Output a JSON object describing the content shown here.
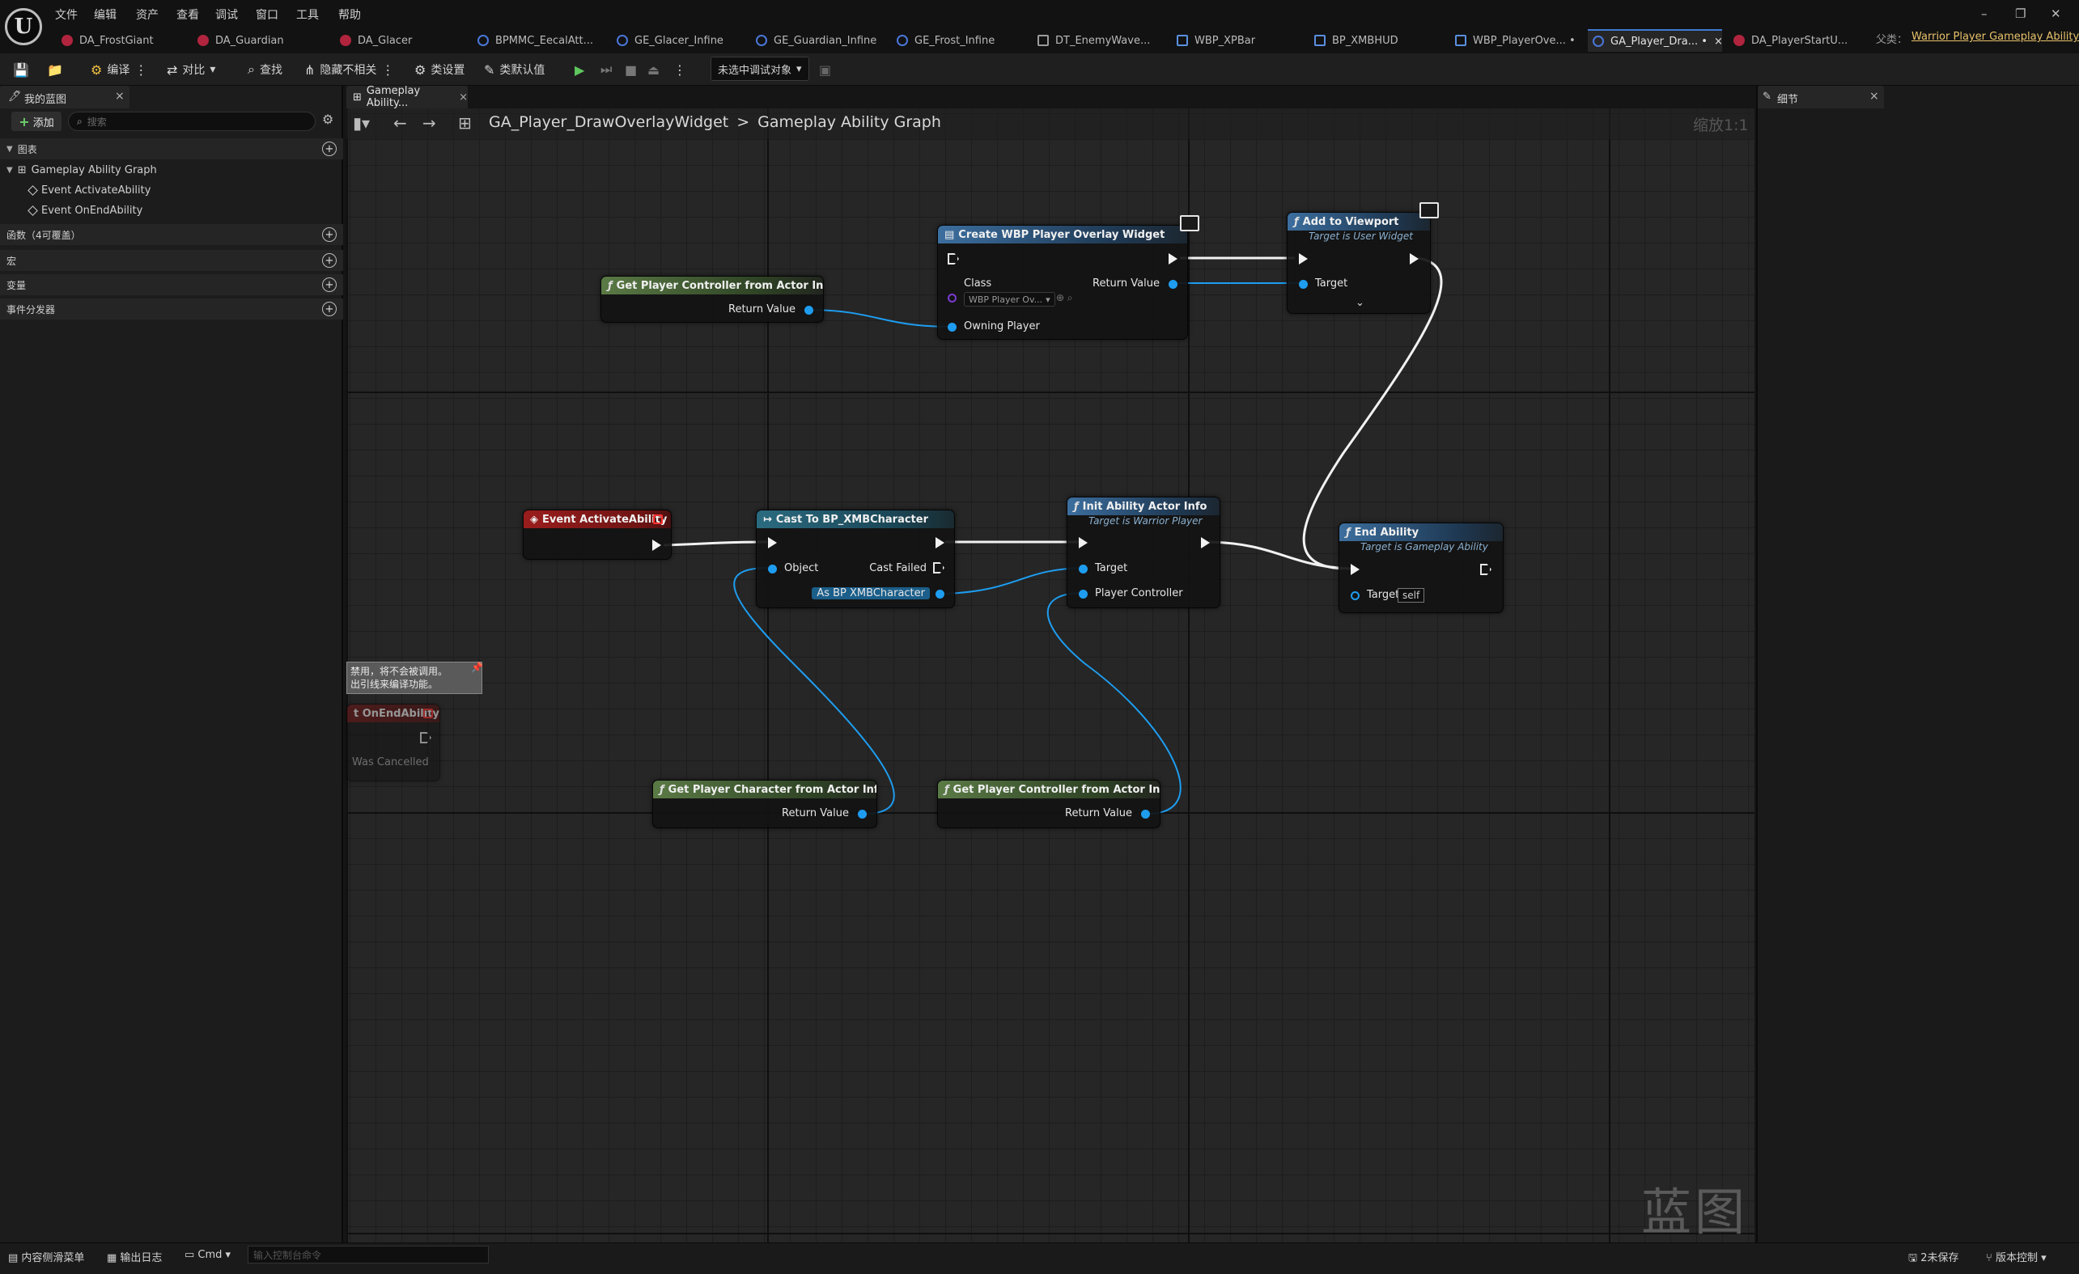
{
  "menu": [
    "文件",
    "编辑",
    "资产",
    "查看",
    "调试",
    "窗口",
    "工具",
    "帮助"
  ],
  "tabs": [
    {
      "label": "DA_FrostGiant",
      "icon": "data-asset-icon"
    },
    {
      "label": "DA_Guardian",
      "icon": "data-asset-icon"
    },
    {
      "label": "DA_Glacer",
      "icon": "data-asset-icon"
    },
    {
      "label": "BPMMC_EecalAtt...",
      "icon": "blueprint-icon"
    },
    {
      "label": "GE_Glacer_Infine",
      "icon": "blueprint-icon"
    },
    {
      "label": "GE_Guardian_Infine",
      "icon": "blueprint-icon"
    },
    {
      "label": "GE_Frost_Infine",
      "icon": "blueprint-icon"
    },
    {
      "label": "DT_EnemyWave...",
      "icon": "data-table-icon"
    },
    {
      "label": "WBP_XPBar",
      "icon": "widget-blueprint-icon"
    },
    {
      "label": "BP_XMBHUD",
      "icon": "blueprint-class-icon"
    },
    {
      "label": "WBP_PlayerOve... •",
      "icon": "widget-blueprint-icon"
    },
    {
      "label": "GA_Player_Dra... •",
      "icon": "blueprint-icon",
      "active": true
    },
    {
      "label": "DA_PlayerStartU...",
      "icon": "data-asset-icon"
    }
  ],
  "tab_close": "×",
  "parent_class_label": "父类：",
  "parent_class": "Warrior Player Gameplay Ability",
  "window_controls": {
    "minimize": "–",
    "restore": "❐",
    "close": "✕"
  },
  "toolbar": {
    "compile": "编译",
    "diff": "对比",
    "find": "查找",
    "hide_unrelated": "隐藏不相关",
    "class_settings": "类设置",
    "class_defaults": "类默认值",
    "debug_object": "未选中调试对象"
  },
  "left_panel": {
    "title": "我的蓝图",
    "add": "添加",
    "search_placeholder": "搜索",
    "sections": {
      "graphs": "图表",
      "functions": "函数（4可覆盖）",
      "macros": "宏",
      "variables": "变量",
      "event_dispatchers": "事件分发器"
    },
    "graph_tree": {
      "root": "Gameplay Ability Graph",
      "items": [
        "Event ActivateAbility",
        "Event OnEndAbility"
      ]
    }
  },
  "graph_tab": "Gameplay Ability...",
  "breadcrumb": {
    "asset": "GA_Player_DrawOverlayWidget",
    "separator": ">",
    "graph": "Gameplay Ability Graph"
  },
  "zoom": "缩放1:1",
  "watermark": "蓝图",
  "details_panel": {
    "title": "细节"
  },
  "nodes": {
    "get_pc_top": {
      "title": "Get Player Controller from Actor Info",
      "out": "Return Value"
    },
    "create_widget": {
      "title": "Create WBP Player Overlay Widget",
      "class_label": "Class",
      "class_value": "WBP Player Ov...",
      "return": "Return Value",
      "owning": "Owning Player"
    },
    "add_viewport": {
      "title": "Add to Viewport",
      "subtitle": "Target is User Widget",
      "target": "Target"
    },
    "event_activate": {
      "title": "Event ActivateAbility"
    },
    "cast": {
      "title": "Cast To BP_XMBCharacter",
      "object": "Object",
      "failed": "Cast Failed",
      "as": "As BP XMBCharacter"
    },
    "init_actor": {
      "title": "Init Ability Actor Info",
      "subtitle": "Target is Warrior Player",
      "target": "Target",
      "pc": "Player Controller"
    },
    "end_ability": {
      "title": "End Ability",
      "subtitle": "Target is Gameplay Ability",
      "target": "Target",
      "self": "self"
    },
    "event_end": {
      "title": "t OnEndAbility",
      "was_cancelled": "Was Cancelled",
      "tip": "禁用，将不会被调用。\n出引线来编译功能。"
    },
    "get_char": {
      "title": "Get Player Character from Actor Info",
      "out": "Return Value"
    },
    "get_pc_bottom": {
      "title": "Get Player Controller from Actor Info",
      "out": "Return Value"
    }
  },
  "statusbar": {
    "content_drawer": "内容侧滑菜单",
    "output_log": "输出日志",
    "cmd": "Cmd",
    "cmd_placeholder": "输入控制台命令",
    "unsaved": "2未保存",
    "source_control": "版本控制"
  }
}
